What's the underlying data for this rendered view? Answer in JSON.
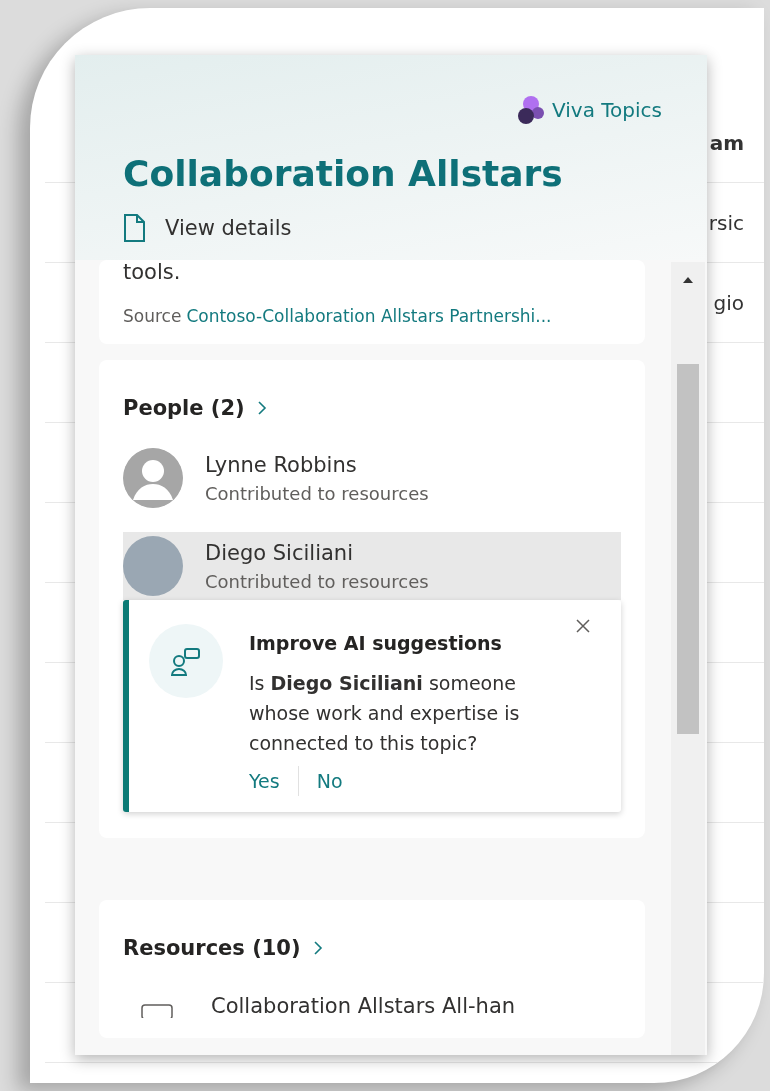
{
  "background_fragments": [
    "am",
    "rsic",
    "gio"
  ],
  "panel": {
    "brand": "Viva Topics",
    "title": "Collaboration Allstars",
    "view_details": "View details"
  },
  "description": {
    "text": "tools.",
    "source_label": "Source",
    "source_link": "Contoso-Collaboration Allstars Partnershi..."
  },
  "people": {
    "heading": "People (2)",
    "items": [
      {
        "name": "Lynne Robbins",
        "subtitle": "Contributed to resources",
        "kind": "silhouette",
        "selected": false
      },
      {
        "name": "Diego Siciliani",
        "subtitle": "Contributed to resources",
        "kind": "photo",
        "selected": true
      }
    ]
  },
  "suggestion": {
    "title": "Improve AI suggestions",
    "question": "Is **Diego Siciliani** someone whose work and expertise is connected to this topic?",
    "actions": [
      "Yes",
      "No"
    ]
  },
  "resources": {
    "heading": "Resources (10)",
    "items": [
      {
        "title": "Collaboration Allstars All-han"
      }
    ]
  }
}
